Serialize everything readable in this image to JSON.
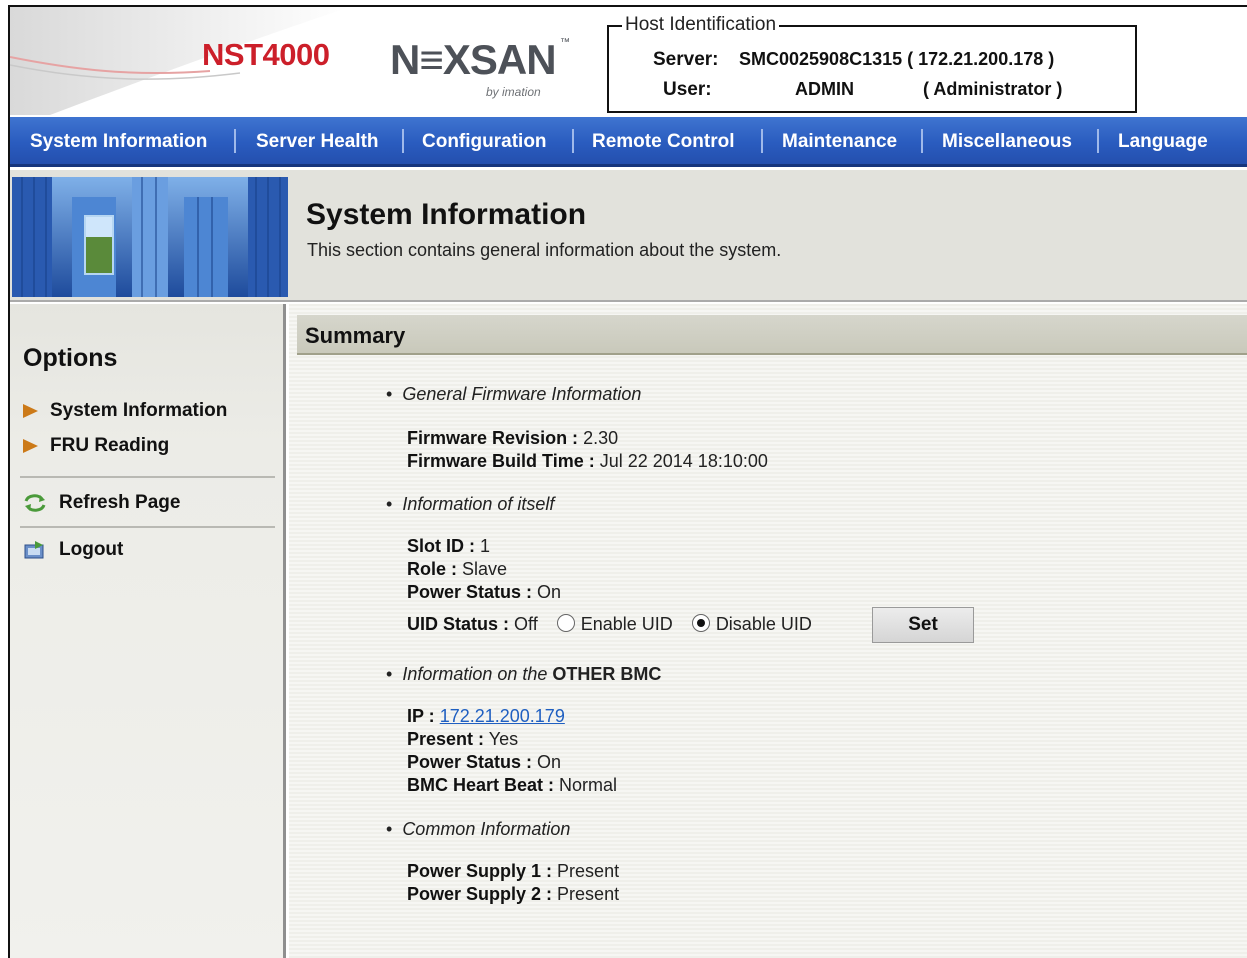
{
  "header": {
    "product_name": "NST4000",
    "brand": "N≡XSAN",
    "brand_tm": "™",
    "brand_sub": "by imation",
    "host_identification": {
      "legend": "Host Identification",
      "server_label": "Server:",
      "server_value": "SMC0025908C1315 ( 172.21.200.178 )",
      "user_label": "User:",
      "user_value": "ADMIN",
      "user_role": "( Administrator )"
    }
  },
  "nav": {
    "items": [
      {
        "label": "System Information"
      },
      {
        "label": "Server Health"
      },
      {
        "label": "Configuration"
      },
      {
        "label": "Remote Control"
      },
      {
        "label": "Maintenance"
      },
      {
        "label": "Miscellaneous"
      },
      {
        "label": "Language"
      }
    ]
  },
  "banner": {
    "title": "System Information",
    "description": "This section contains general information about the system."
  },
  "sidebar": {
    "title": "Options",
    "items": [
      {
        "label": "System Information",
        "icon": "arrow-icon"
      },
      {
        "label": "FRU Reading",
        "icon": "arrow-icon"
      },
      {
        "label": "Refresh Page",
        "icon": "refresh-icon"
      },
      {
        "label": "Logout",
        "icon": "logout-icon"
      }
    ]
  },
  "summary": {
    "title": "Summary",
    "firmware": {
      "heading": "General Firmware Information",
      "revision_label": "Firmware Revision :",
      "revision_value": "2.30",
      "build_time_label": "Firmware Build Time :",
      "build_time_value": "Jul 22 2014 18:10:00"
    },
    "itself": {
      "heading": "Information of itself",
      "slot_label": "Slot ID :",
      "slot_value": "1",
      "role_label": "Role :",
      "role_value": "Slave",
      "power_label": "Power Status :",
      "power_value": "On",
      "uid_label": "UID Status :",
      "uid_value": "Off",
      "enable_uid_label": "Enable UID",
      "disable_uid_label": "Disable UID",
      "selected": "Disable UID",
      "set_label": "Set"
    },
    "other_bmc": {
      "heading_prefix": "Information on the",
      "heading_strong": "OTHER BMC",
      "ip_label": "IP :",
      "ip_value": "172.21.200.179",
      "present_label": "Present :",
      "present_value": "Yes",
      "power_label": "Power Status :",
      "power_value": "On",
      "heartbeat_label": "BMC Heart Beat :",
      "heartbeat_value": "Normal"
    },
    "common": {
      "heading": "Common Information",
      "ps1_label": "Power Supply 1 :",
      "ps1_value": "Present",
      "ps2_label": "Power Supply 2 :",
      "ps2_value": "Present"
    }
  }
}
